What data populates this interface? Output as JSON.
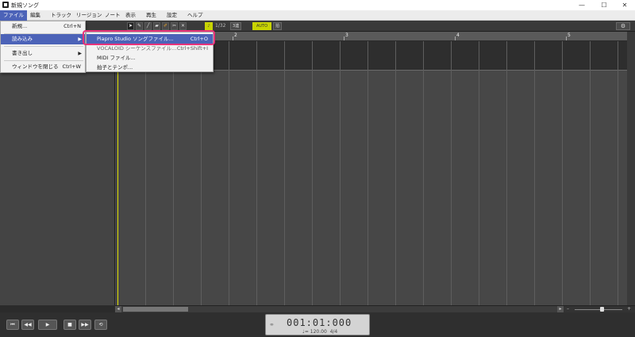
{
  "window": {
    "title": "新規ソング",
    "controls": {
      "minimize": "—",
      "maximize": "☐",
      "close": "✕"
    }
  },
  "menubar": {
    "items": [
      "ファイル",
      "編集",
      "トラック",
      "リージョン",
      "ノート",
      "表示",
      "再生",
      "設定",
      "ヘルプ"
    ],
    "active": "ファイル"
  },
  "toolbar": {
    "tools": [
      "pointer",
      "pencil",
      "line",
      "eraser",
      "brush",
      "scissors",
      "close"
    ],
    "quantize": "1/32",
    "quantize_dropdown": "3連",
    "mode_button": "AUTO",
    "mode_value": "拍"
  },
  "ruler": {
    "labels": [
      "2",
      "3",
      "4",
      "5"
    ]
  },
  "file_menu": {
    "items": [
      {
        "label": "新規...",
        "shortcut": "Ctrl+N"
      },
      {
        "label": "読み込み",
        "submenu": true
      },
      {
        "label": "書き出し",
        "submenu": true
      },
      {
        "label": "ウィンドウを閉じる",
        "shortcut": "Ctrl+W"
      }
    ]
  },
  "import_submenu": {
    "items": [
      {
        "label": "Piapro Studio ソングファイル...",
        "shortcut": "Ctrl+O"
      },
      {
        "label": "VOCALOID シーケンスファイル...",
        "shortcut": "Ctrl+Shift+I"
      },
      {
        "label": "MIDI ファイル...",
        "shortcut": ""
      },
      {
        "label": "拍子とテンポ...",
        "shortcut": ""
      }
    ]
  },
  "transport": {
    "buttons": [
      "⏮",
      "◀◀",
      "▶",
      "■",
      "▶▶",
      "⟲"
    ],
    "time": "001:01:000",
    "tempo": "♩= 120.00",
    "time_signature": "4/4"
  },
  "colors": {
    "accent": "#4c63b8",
    "playhead": "#e0e000",
    "highlight_outline": "#e8327a"
  }
}
